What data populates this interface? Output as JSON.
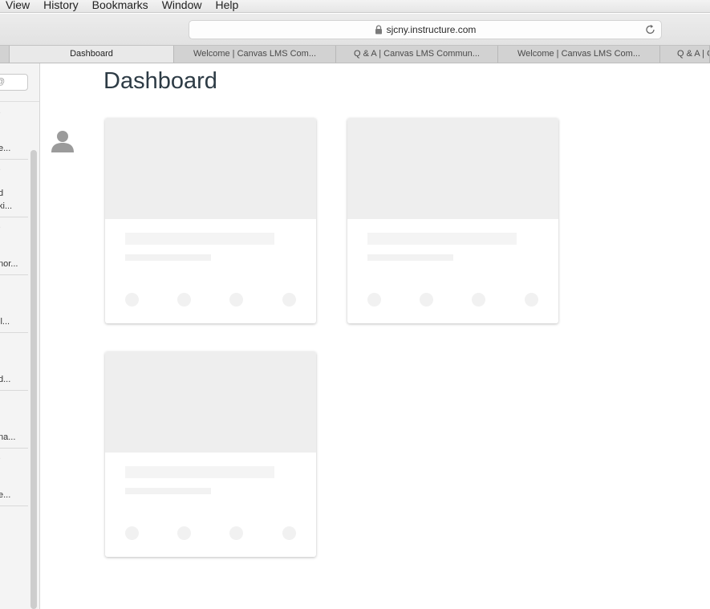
{
  "menubar": {
    "items": [
      "View",
      "History",
      "Bookmarks",
      "Window",
      "Help"
    ]
  },
  "toolbar": {
    "url": "sjcny.instructure.com"
  },
  "tabs": [
    {
      "label": "Dashboard",
      "active": true
    },
    {
      "label": "Welcome | Canvas LMS Com...",
      "active": false
    },
    {
      "label": "Q & A | Canvas LMS Commun...",
      "active": false
    },
    {
      "label": "Welcome | Canvas LMS Com...",
      "active": false
    },
    {
      "label": "Q & A | C",
      "active": false
    }
  ],
  "sidebar": {
    "search_placeholder": "@",
    "items": [
      {
        "line1": ".",
        "line2": "e..."
      },
      {
        "line1": ".",
        "line2": "d",
        "line3": "ki..."
      },
      {
        "line1": ".",
        "line2": "nor..."
      },
      {
        "line1": "",
        "line2": "il..."
      },
      {
        "line1": "",
        "line2": "d..."
      },
      {
        "line1": "",
        "line2": "na..."
      },
      {
        "line1": ".",
        "line2": "e..."
      }
    ]
  },
  "main": {
    "title": "Dashboard"
  },
  "colors": {
    "title": "#2d3b45",
    "placeholder_hero": "#eeeeee",
    "placeholder_line": "#f4f4f4"
  },
  "icons": [
    "lock-icon",
    "reload-icon",
    "avatar-icon"
  ]
}
